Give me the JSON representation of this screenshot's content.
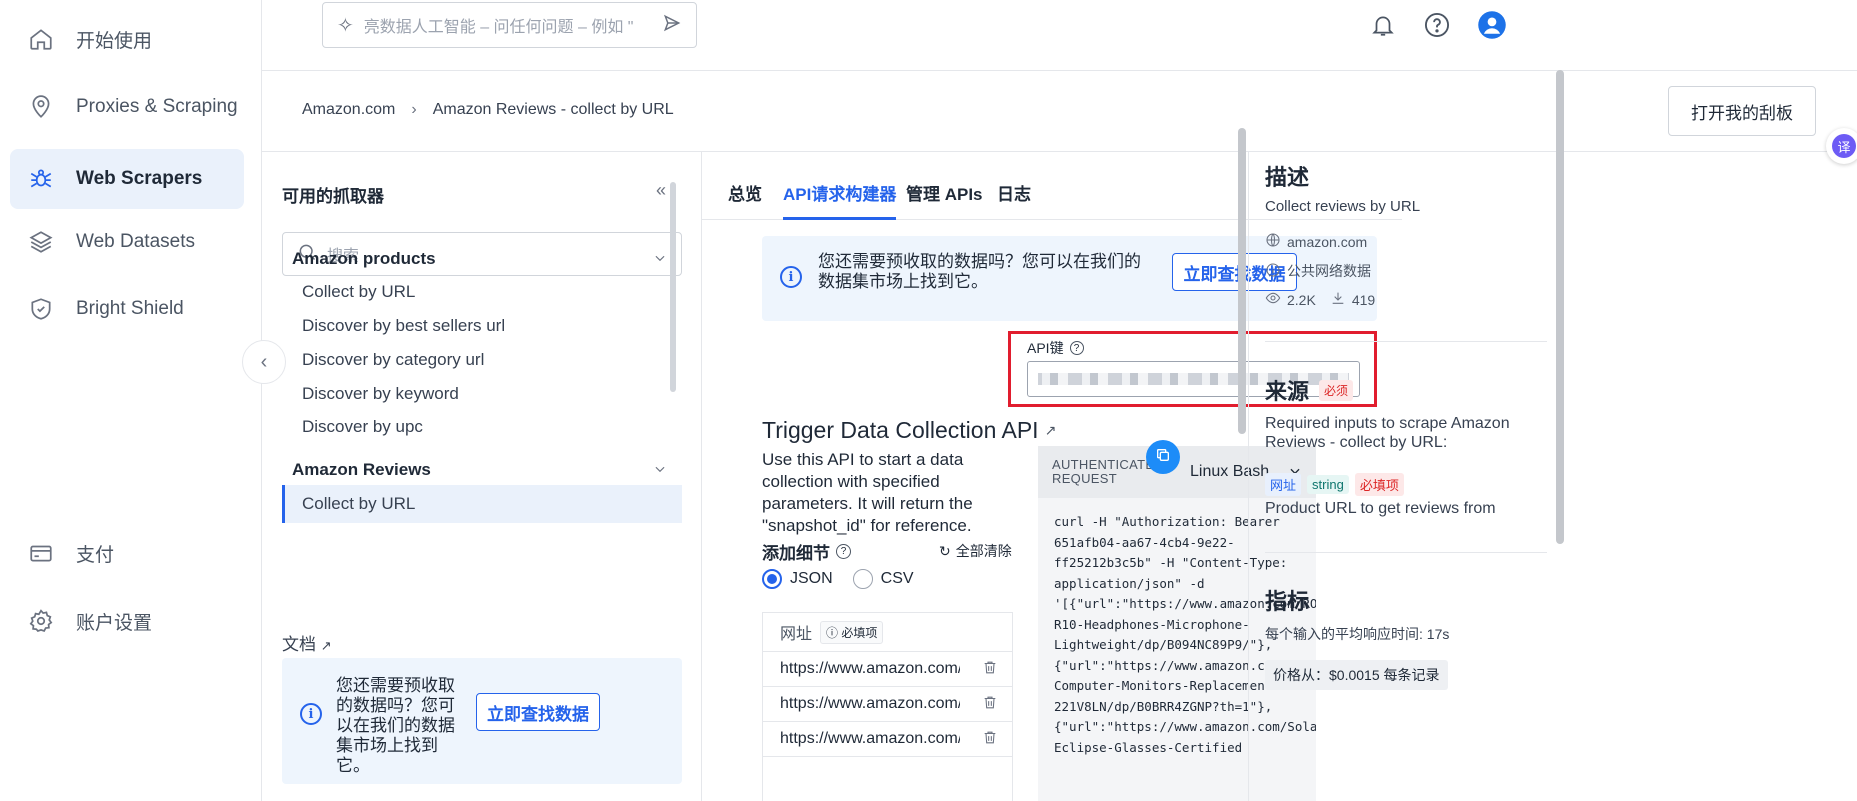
{
  "nav": {
    "items": [
      {
        "label": "开始使用",
        "icon": "home-icon"
      },
      {
        "label": "Proxies & Scraping",
        "icon": "location-pin-icon"
      },
      {
        "label": "Web Scrapers",
        "icon": "spider-icon"
      },
      {
        "label": "Web Datasets",
        "icon": "layers-icon"
      },
      {
        "label": "Bright Shield",
        "icon": "shield-icon"
      }
    ],
    "bottom": [
      {
        "label": "支付",
        "icon": "card-icon"
      },
      {
        "label": "账户设置",
        "icon": "gear-icon"
      }
    ]
  },
  "topbar": {
    "search_placeholder": "亮数据人工智能 – 问任何问题 – 例如 \""
  },
  "breadcrumb": {
    "root": "Amazon.com",
    "current": "Amazon Reviews - collect by URL"
  },
  "dashboard_button": "打开我的刮板",
  "translate_badge": "译",
  "scrapers": {
    "title": "可用的抓取器",
    "collapse": "«",
    "search_placeholder": "搜索",
    "groups": [
      {
        "name": "Amazon products",
        "items": [
          "Collect by URL",
          "Discover by best sellers url",
          "Discover by category url",
          "Discover by keyword",
          "Discover by upc"
        ]
      },
      {
        "name": "Amazon Reviews",
        "items": [
          "Collect by URL"
        ]
      }
    ],
    "docs": "文档"
  },
  "notice": {
    "text_left": "您还需要预收取的数据吗？您可以在我们的数据集市场上找到它。",
    "text_mid": "您还需要预收取的数据吗？您可以在我们的数据集市场上找到它。",
    "button": "立即查找数据"
  },
  "tabs": [
    "总览",
    "API请求构建器",
    "管理 APIs",
    "日志"
  ],
  "api_key": {
    "label": "API键"
  },
  "trigger": {
    "title": "Trigger Data Collection API",
    "description": "Use this API to start a data collection with specified parameters. It will return the \"snapshot_id\" for reference.",
    "details_title": "添加细节",
    "clear_all": "全部清除",
    "format_json": "JSON",
    "format_csv": "CSV",
    "url_header": "网址",
    "required": "必填项",
    "urls": [
      "https://www.amazon.com/",
      "https://www.amazon.com/",
      "https://www.amazon.com/"
    ]
  },
  "code": {
    "auth_label": "AUTHENTICATED REQUEST",
    "language": "Linux Bash",
    "lines": [
      "curl -H \"Authorization: Bearer",
      "651afb04-aa67-4cb4-9e22-",
      "ff25212b3c5b\" -H \"Content-Type:",
      "application/json\" -d",
      "'[{\"url\":\"https://www.amazon.com/RORSOU-",
      "R10-Headphones-Microphone-",
      "Lightweight/dp/B094NC89P9/\"},",
      "{\"url\":\"https://www.amazon.com/PHILIPS-",
      "Computer-Monitors-Replacement-",
      "221V8LN/dp/B0BRR4ZGNP?th=1\"},",
      "{\"url\":\"https://www.amazon.com/Solar-",
      "Eclipse-Glasses-Certified"
    ]
  },
  "right": {
    "desc_title": "描述",
    "desc_text": "Collect reviews by URL",
    "domain": "amazon.com",
    "public": "公共网络数据",
    "views": "2.2K",
    "downloads": "419",
    "source_title": "来源",
    "source_badge": "必须",
    "source_text": "Required inputs to scrape Amazon Reviews - collect by URL:",
    "chips": [
      "网址",
      "string",
      "必填项"
    ],
    "input_desc": "Product URL to get reviews from",
    "metrics_title": "指标",
    "metrics_text": "每个输入的平均响应时间: 17s",
    "price": "价格从：$0.0015 每条记录"
  }
}
